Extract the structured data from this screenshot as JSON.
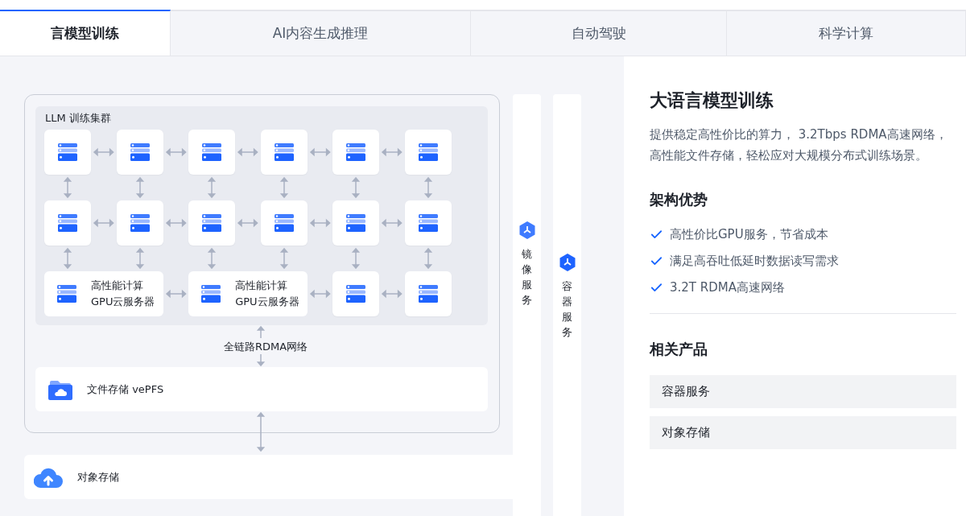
{
  "tabs": [
    {
      "label": "言模型训练",
      "selected": true
    },
    {
      "label": "AI内容生成推理",
      "selected": false
    },
    {
      "label": "自动驾驶",
      "selected": false
    },
    {
      "label": "科学计算",
      "selected": false
    }
  ],
  "diagram": {
    "cluster_title": "LLM 训练集群",
    "rows": [
      [
        {
          "kind": "server"
        },
        {
          "kind": "server"
        },
        {
          "kind": "server"
        },
        {
          "kind": "server"
        },
        {
          "kind": "server"
        },
        {
          "kind": "server"
        }
      ],
      [
        {
          "kind": "server"
        },
        {
          "kind": "server"
        },
        {
          "kind": "server"
        },
        {
          "kind": "server"
        },
        {
          "kind": "server"
        },
        {
          "kind": "server"
        }
      ],
      [
        {
          "kind": "gpu",
          "lines": [
            "高性能计算",
            "GPU云服务器"
          ]
        },
        {
          "kind": "gpu",
          "lines": [
            "高性能计算",
            "GPU云服务器"
          ]
        },
        {
          "kind": "server"
        },
        {
          "kind": "server"
        }
      ]
    ],
    "network_label": "全链路RDMA网络",
    "file_storage": "文件存储 vePFS",
    "object_storage": "对象存储",
    "side_services": [
      "镜像服务",
      "容器服务"
    ]
  },
  "panel": {
    "title": "大语言模型训练",
    "description": "提供稳定高性价比的算力， 3.2Tbps RDMA高速网络，高性能文件存储，轻松应对大规模分布式训练场景。",
    "advantages_title": "架构优势",
    "advantages": [
      "高性价比GPU服务，节省成本",
      "满足高吞吐低延时数据读写需求",
      "3.2T RDMA高速网络"
    ],
    "related_title": "相关产品",
    "related": [
      "容器服务",
      "对象存储"
    ]
  }
}
